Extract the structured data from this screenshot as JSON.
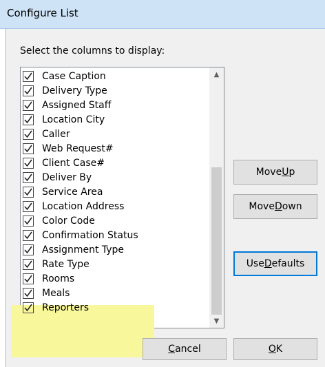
{
  "window": {
    "title": "Configure List"
  },
  "prompt": "Select the columns to display:",
  "list": {
    "items": [
      {
        "label": "Case Caption",
        "checked": true
      },
      {
        "label": "Delivery Type",
        "checked": true
      },
      {
        "label": "Assigned Staff",
        "checked": true
      },
      {
        "label": "Location City",
        "checked": true
      },
      {
        "label": "Caller",
        "checked": true
      },
      {
        "label": "Web Request#",
        "checked": true
      },
      {
        "label": "Client Case#",
        "checked": true
      },
      {
        "label": "Deliver By",
        "checked": true
      },
      {
        "label": "Service Area",
        "checked": true
      },
      {
        "label": "Location Address",
        "checked": true
      },
      {
        "label": "Color Code",
        "checked": true
      },
      {
        "label": "Confirmation Status",
        "checked": true
      },
      {
        "label": "Assignment Type",
        "checked": true
      },
      {
        "label": "Rate Type",
        "checked": true
      },
      {
        "label": "Rooms",
        "checked": true
      },
      {
        "label": "Meals",
        "checked": true
      },
      {
        "label": "Reporters",
        "checked": true
      }
    ],
    "highlight_color": "#f9f79b"
  },
  "buttons": {
    "move_up": {
      "pre": "Move ",
      "mnemonic": "U",
      "post": "p"
    },
    "move_down": {
      "pre": "Move ",
      "mnemonic": "D",
      "post": "own"
    },
    "use_defaults": {
      "pre": "Use ",
      "mnemonic": "D",
      "post": "efaults"
    },
    "cancel": {
      "pre": "",
      "mnemonic": "C",
      "post": "ancel"
    },
    "ok": {
      "pre": "",
      "mnemonic": "O",
      "post": "K"
    }
  }
}
